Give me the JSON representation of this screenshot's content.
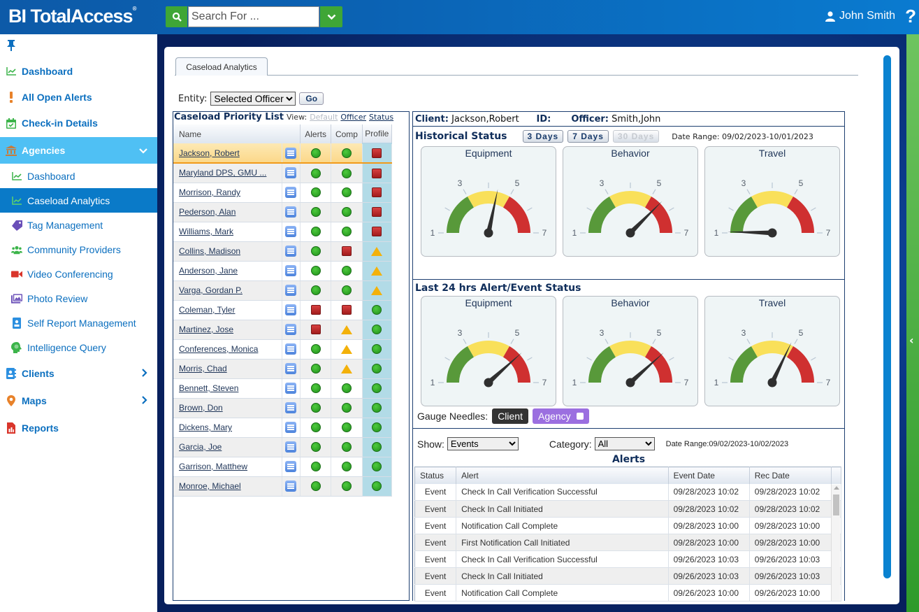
{
  "header": {
    "logo": "BI TotalAccess",
    "search_placeholder": "Search For ...",
    "user_name": "John Smith",
    "help_label": "?"
  },
  "sidebar": {
    "items": [
      {
        "label": "Dashboard",
        "icon": "chart-line-icon",
        "level": "top"
      },
      {
        "label": "All Open Alerts",
        "icon": "exclamation-icon",
        "level": "top"
      },
      {
        "label": "Check-in Details",
        "icon": "calendar-check-icon",
        "level": "top"
      },
      {
        "label": "Agencies",
        "icon": "bank-icon",
        "level": "top",
        "expanded": true
      },
      {
        "label": "Dashboard",
        "icon": "chart-line-icon",
        "level": "sub"
      },
      {
        "label": "Caseload Analytics",
        "icon": "chart-line-icon",
        "level": "sub",
        "active": true
      },
      {
        "label": "Tag Management",
        "icon": "tag-icon",
        "level": "sub"
      },
      {
        "label": "Community Providers",
        "icon": "users-icon",
        "level": "sub"
      },
      {
        "label": "Video Conferencing",
        "icon": "video-icon",
        "level": "sub"
      },
      {
        "label": "Photo Review",
        "icon": "images-icon",
        "level": "sub"
      },
      {
        "label": "Self Report Management",
        "icon": "id-badge-icon",
        "level": "sub"
      },
      {
        "label": "Intelligence Query",
        "icon": "brain-head-icon",
        "level": "sub"
      },
      {
        "label": "Clients",
        "icon": "address-book-icon",
        "level": "top"
      },
      {
        "label": "Maps",
        "icon": "map-marker-icon",
        "level": "top"
      },
      {
        "label": "Reports",
        "icon": "report-file-icon",
        "level": "top"
      }
    ]
  },
  "tab": {
    "label": "Caseload Analytics"
  },
  "entity": {
    "label": "Entity:",
    "selected": "Selected Officer",
    "go_label": "Go"
  },
  "caseload": {
    "title": "Caseload Priority List",
    "view_label": "View:",
    "views": [
      "Default",
      "Officer",
      "Status"
    ],
    "columns": [
      "Name",
      "Alerts",
      "Comp",
      "Profile"
    ],
    "rows": [
      {
        "name": "Jackson, Robert",
        "alerts": "green",
        "comp": "green",
        "profile": "red",
        "selected": true
      },
      {
        "name": "Maryland DPS, GMU ...",
        "alerts": "green",
        "comp": "green",
        "profile": "red"
      },
      {
        "name": "Morrison, Randy",
        "alerts": "green",
        "comp": "green",
        "profile": "red"
      },
      {
        "name": "Pederson, Alan",
        "alerts": "green",
        "comp": "green",
        "profile": "red"
      },
      {
        "name": "Williams, Mark",
        "alerts": "green",
        "comp": "green",
        "profile": "red"
      },
      {
        "name": "Collins, Madison",
        "alerts": "green",
        "comp": "red",
        "profile": "yellow"
      },
      {
        "name": "Anderson, Jane",
        "alerts": "green",
        "comp": "green",
        "profile": "yellow"
      },
      {
        "name": "Varga, Gordan P.",
        "alerts": "green",
        "comp": "green",
        "profile": "yellow"
      },
      {
        "name": "Coleman, Tyler",
        "alerts": "red",
        "comp": "red",
        "profile": "green"
      },
      {
        "name": "Martinez, Jose",
        "alerts": "red",
        "comp": "yellow",
        "profile": "green"
      },
      {
        "name": "Conferences, Monica",
        "alerts": "green",
        "comp": "yellow",
        "profile": "green"
      },
      {
        "name": "Morris, Chad",
        "alerts": "green",
        "comp": "yellow",
        "profile": "green"
      },
      {
        "name": "Bennett, Steven",
        "alerts": "green",
        "comp": "green",
        "profile": "green"
      },
      {
        "name": "Brown, Don",
        "alerts": "green",
        "comp": "green",
        "profile": "green"
      },
      {
        "name": "Dickens, Mary",
        "alerts": "green",
        "comp": "green",
        "profile": "green"
      },
      {
        "name": "Garcia, Joe",
        "alerts": "green",
        "comp": "green",
        "profile": "green"
      },
      {
        "name": "Garrison, Matthew",
        "alerts": "green",
        "comp": "green",
        "profile": "green"
      },
      {
        "name": "Monroe, Michael",
        "alerts": "green",
        "comp": "green",
        "profile": "green"
      }
    ]
  },
  "client_info": {
    "client_label": "Client:",
    "client": "Jackson,Robert",
    "id_label": "ID:",
    "id": "",
    "officer_label": "Officer:",
    "officer": "Smith,John"
  },
  "historical": {
    "title": "Historical Status",
    "buttons": [
      {
        "label": "3 Days",
        "enabled": true
      },
      {
        "label": "7 Days",
        "enabled": true
      },
      {
        "label": "30 Days",
        "enabled": false
      }
    ],
    "date_range": "Date Range: 09/02/2023-10/01/2023",
    "gauges": [
      {
        "title": "Equipment",
        "value": 4.4
      },
      {
        "title": "Behavior",
        "value": 5.5
      },
      {
        "title": "Travel",
        "value": 1.05
      }
    ]
  },
  "last24": {
    "title": "Last 24 hrs Alert/Event Status",
    "gauges": [
      {
        "title": "Equipment",
        "value": 5.6
      },
      {
        "title": "Behavior",
        "value": 5.6
      },
      {
        "title": "Travel",
        "value": 4.85
      }
    ]
  },
  "gauge_scale": {
    "min": 1,
    "max": 7,
    "labels": [
      "1",
      "3",
      "5",
      "7"
    ],
    "bands": [
      {
        "from": 1,
        "to": 3,
        "color": "#58993a"
      },
      {
        "from": 3,
        "to": 5,
        "color": "#f9e05a"
      },
      {
        "from": 5,
        "to": 7,
        "color": "#cf3030"
      }
    ]
  },
  "needles": {
    "label": "Gauge Needles:",
    "client": "Client",
    "agency": "Agency"
  },
  "filters": {
    "show_label": "Show:",
    "show_value": "Events",
    "category_label": "Category:",
    "category_value": "All",
    "date_range": "Date Range:09/02/2023-10/02/2023"
  },
  "alerts": {
    "title": "Alerts",
    "columns": [
      "Status",
      "Alert",
      "Event Date",
      "Rec Date"
    ],
    "rows": [
      [
        "Event",
        "Check In Call Verification Successful",
        "09/28/2023 10:02",
        "09/28/2023 10:02"
      ],
      [
        "Event",
        "Check In Call Initiated",
        "09/28/2023 10:02",
        "09/28/2023 10:02"
      ],
      [
        "Event",
        "Notification Call Complete",
        "09/28/2023 10:00",
        "09/28/2023 10:00"
      ],
      [
        "Event",
        "First Notification Call Initiated",
        "09/28/2023 10:00",
        "09/28/2023 10:00"
      ],
      [
        "Event",
        "Check In Call Verification Successful",
        "09/26/2023 10:03",
        "09/26/2023 10:03"
      ],
      [
        "Event",
        "Check In Call Initiated",
        "09/26/2023 10:03",
        "09/26/2023 10:03"
      ],
      [
        "Event",
        "Notification Call Complete",
        "09/26/2023 10:00",
        "09/26/2023 10:00"
      ]
    ]
  }
}
